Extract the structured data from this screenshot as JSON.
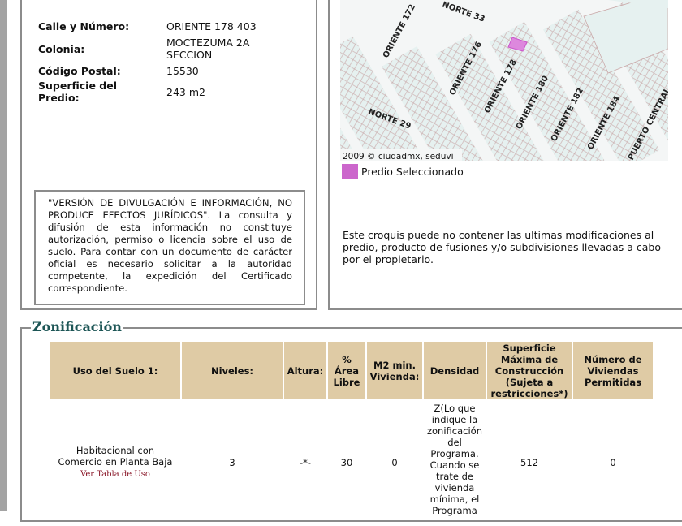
{
  "predio": {
    "fields": [
      {
        "label": "Calle y Número:",
        "value": "ORIENTE 178 403"
      },
      {
        "label": "Colonia:",
        "value": "MOCTEZUMA 2A SECCION"
      },
      {
        "label": "Código Postal:",
        "value": "15530"
      },
      {
        "label": "Superficie del Predio:",
        "value": "243 m2"
      }
    ],
    "disclaimer": "\"VERSIÓN DE DIVULGACIÓN E INFORMACIÓN, NO PRODUCE EFECTOS JURÍDICOS\". La consulta y difusión de esta información no constituye autorización, permiso o licencia sobre el uso de suelo. Para contar con un documento de carácter oficial es necesario solicitar a la autoridad competente, la expedición del Certificado correspondiente."
  },
  "map": {
    "streets": [
      "ORIENTE 172",
      "NORTE 33",
      "ORIENTE 176",
      "ORIENTE 178",
      "ORIENTE 180",
      "ORIENTE 182",
      "ORIENTE 184",
      "NORTE 29",
      "PUERTO CENTRAL"
    ],
    "copyright": "2009 © ciudadmx, seduvi",
    "legend_label": "Predio Seleccionado",
    "legend_color": "#cc66cc",
    "note": "Este croquis puede no contener las ultimas modificaciones al predio, producto de fusiones y/o subdivisiones llevadas a cabo por el propietario."
  },
  "zonificacion": {
    "title": "Zonificación",
    "headers": [
      "Uso del Suelo 1:",
      "Niveles:",
      "Altura:",
      "% Área Libre",
      "M2 min. Vivienda:",
      "Densidad",
      "Superficie Máxima de Construcción (Sujeta a restricciones*)",
      "Número de Viviendas Permitidas"
    ],
    "row": {
      "uso": "Habitacional con Comercio en Planta Baja",
      "uso_link": "Ver Tabla de Uso",
      "niveles": "3",
      "altura": "-*-",
      "area_libre": "30",
      "m2_min": "0",
      "densidad": "Z(Lo que indique la zonificación del Programa. Cuando se trate de vivienda mínima, el Programa",
      "superficie_max": "512",
      "viviendas": "0"
    }
  }
}
